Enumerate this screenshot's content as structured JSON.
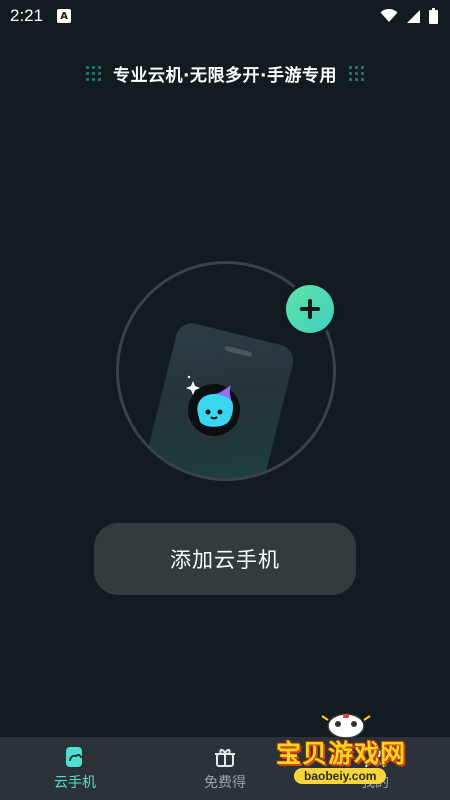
{
  "status_bar": {
    "time": "2:21",
    "notification_badge": "A"
  },
  "slogan": "专业云机·无限多开·手游专用",
  "add_button_label": "添加云手机",
  "bottom_nav": {
    "items": [
      {
        "label": "云手机",
        "icon": "cloud-phone-icon",
        "active": true
      },
      {
        "label": "免费得",
        "icon": "gift-icon",
        "active": false
      },
      {
        "label": "我的",
        "icon": "profile-icon",
        "active": false
      }
    ]
  },
  "watermark": {
    "title": "宝贝游戏网",
    "url": "baobeiy.com"
  },
  "colors": {
    "background": "#121b1f",
    "accent": "#4fe0d0",
    "plus_gradient_start": "#5fe3a6",
    "plus_gradient_end": "#3fcfc0",
    "button_bg": "#343b3f",
    "nav_bg": "#2b3338"
  }
}
